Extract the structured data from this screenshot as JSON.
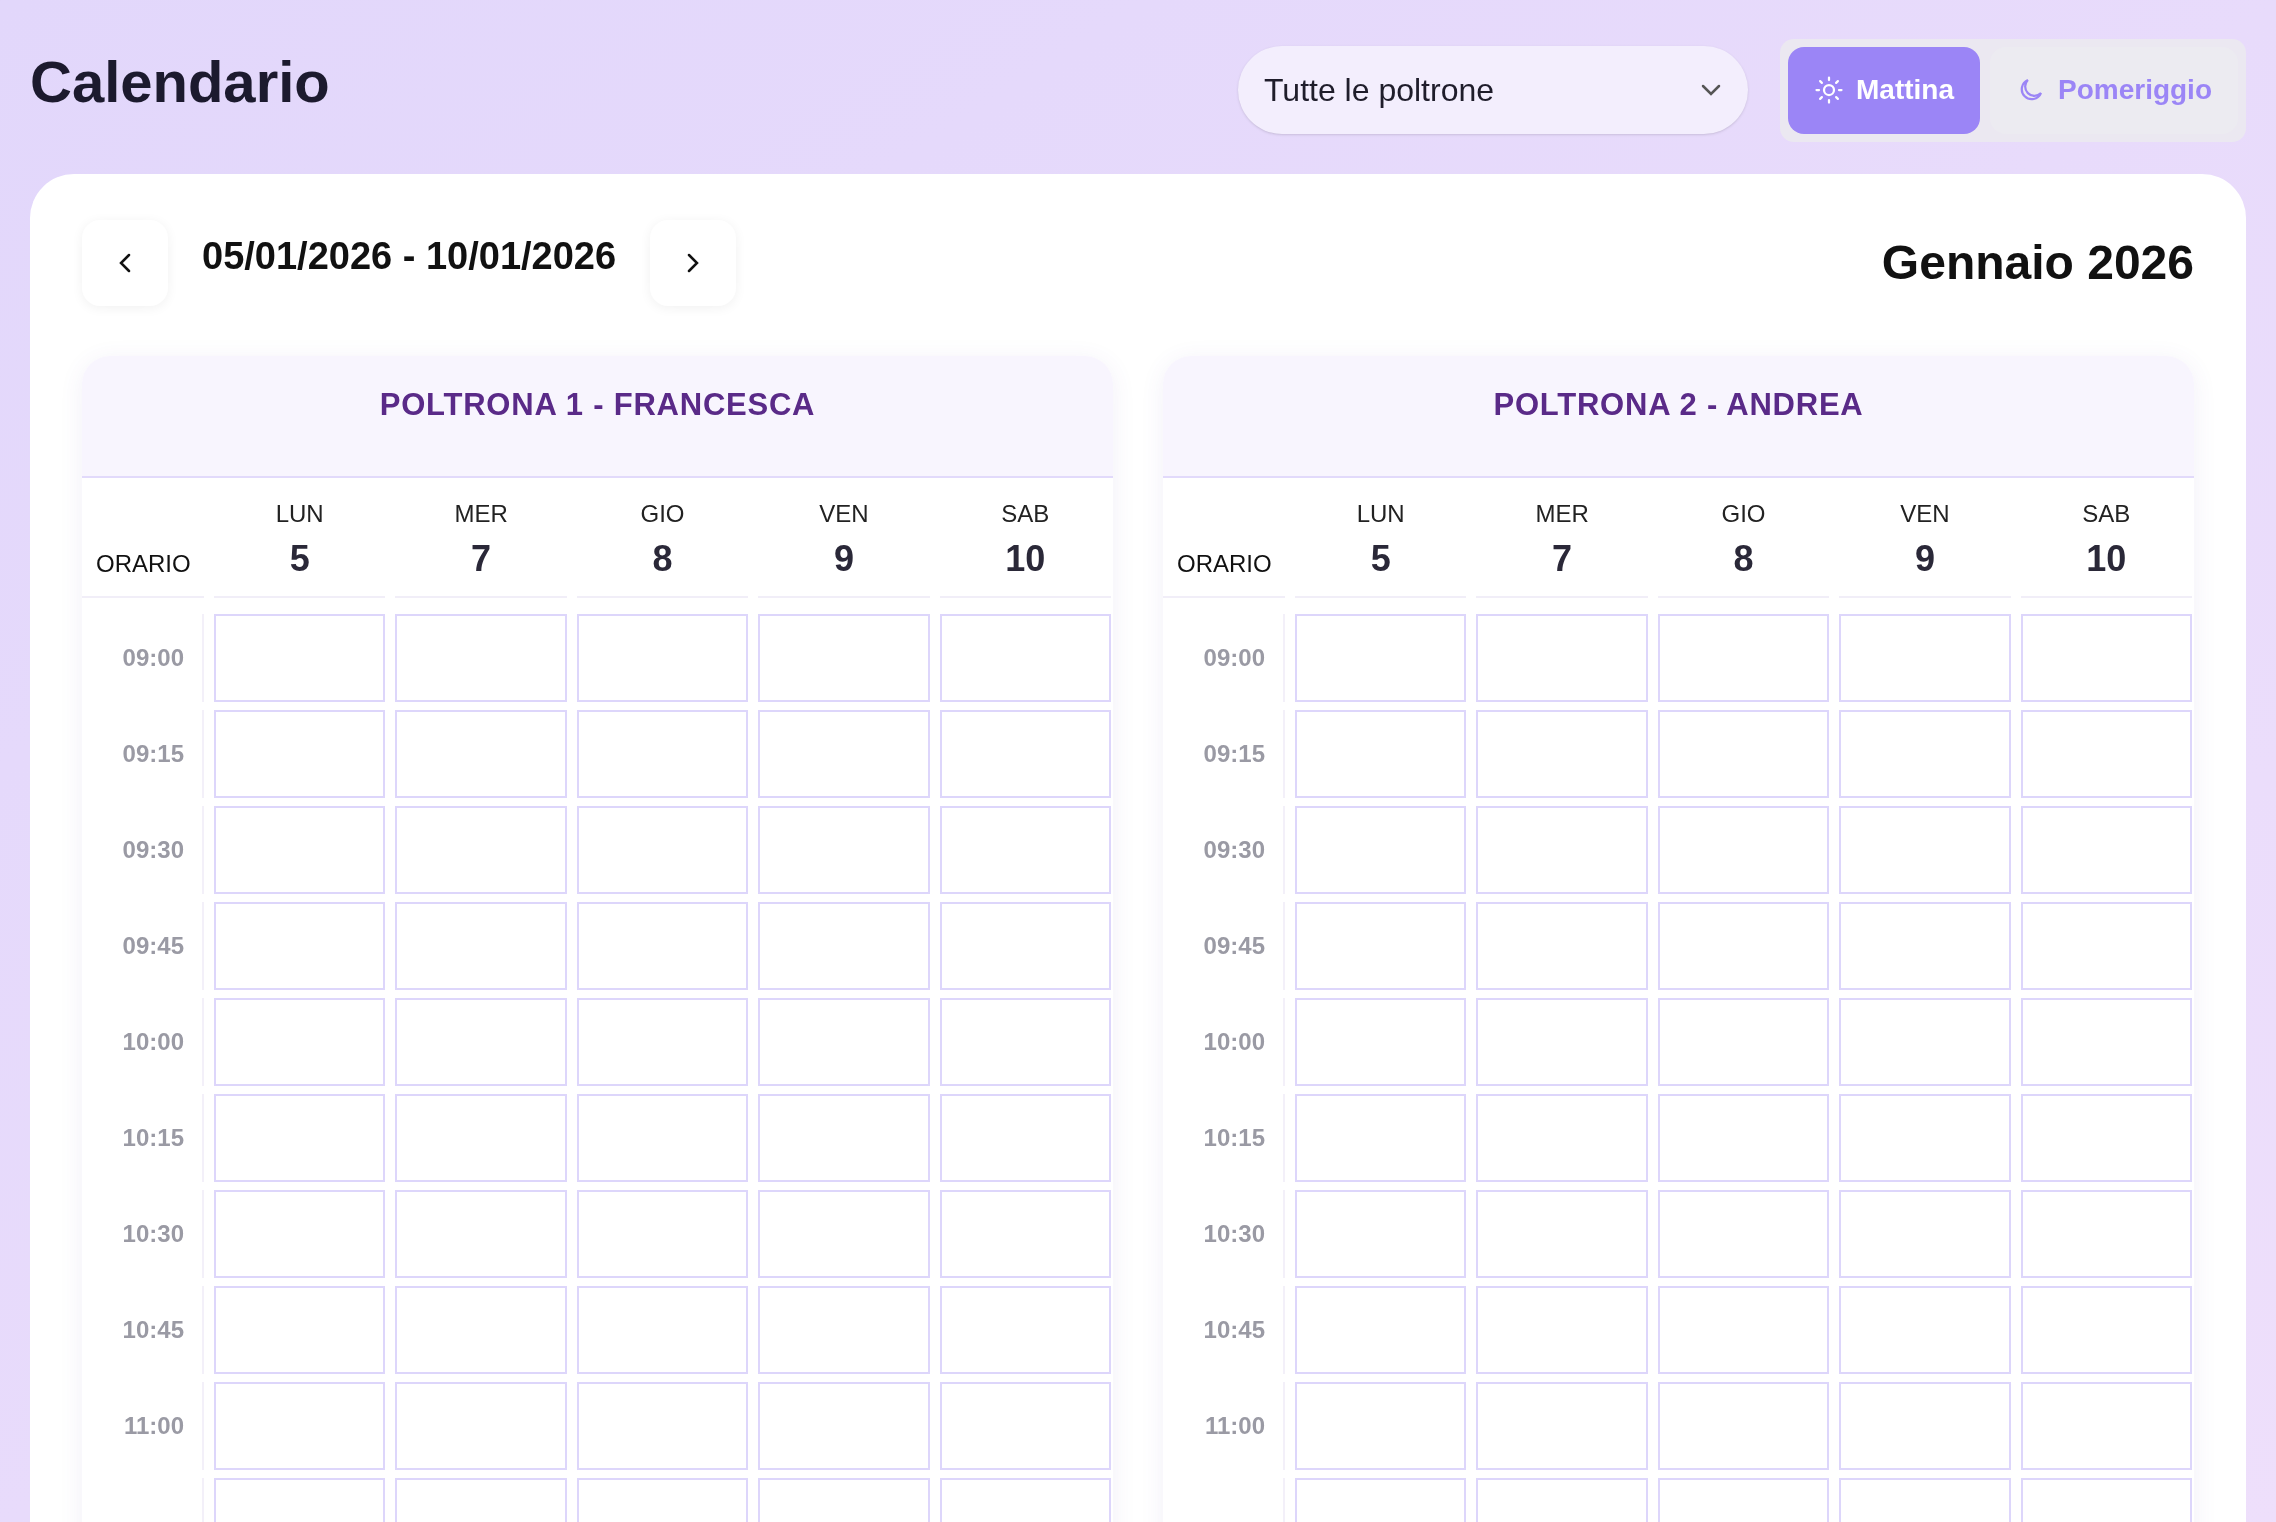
{
  "title": "Calendario",
  "chair_filter": {
    "value": "Tutte le poltrone"
  },
  "modes": [
    {
      "label": "Mattina",
      "kind": "sun",
      "selected": true
    },
    {
      "label": "Pomeriggio",
      "kind": "moon",
      "selected": false
    }
  ],
  "week_range": "05/01/2026 - 10/01/2026",
  "month": "Gennaio 2026",
  "chairs": [
    {
      "title": "POLTRONA 1 - FRANCESCA",
      "time_header": "ORARIO",
      "days": [
        {
          "weekday": "LUN",
          "day": "5"
        },
        {
          "weekday": "MER",
          "day": "7"
        },
        {
          "weekday": "GIO",
          "day": "8"
        },
        {
          "weekday": "VEN",
          "day": "9"
        },
        {
          "weekday": "SAB",
          "day": "10"
        }
      ],
      "times": [
        "09:00",
        "09:15",
        "09:30",
        "09:45",
        "10:00",
        "10:15",
        "10:30",
        "10:45",
        "11:00"
      ]
    },
    {
      "title": "POLTRONA 2 - ANDREA",
      "time_header": "ORARIO",
      "days": [
        {
          "weekday": "LUN",
          "day": "5"
        },
        {
          "weekday": "MER",
          "day": "7"
        },
        {
          "weekday": "GIO",
          "day": "8"
        },
        {
          "weekday": "VEN",
          "day": "9"
        },
        {
          "weekday": "SAB",
          "day": "10"
        }
      ],
      "times": [
        "09:00",
        "09:15",
        "09:30",
        "09:45",
        "10:00",
        "10:15",
        "10:30",
        "10:45",
        "11:00"
      ]
    }
  ]
}
